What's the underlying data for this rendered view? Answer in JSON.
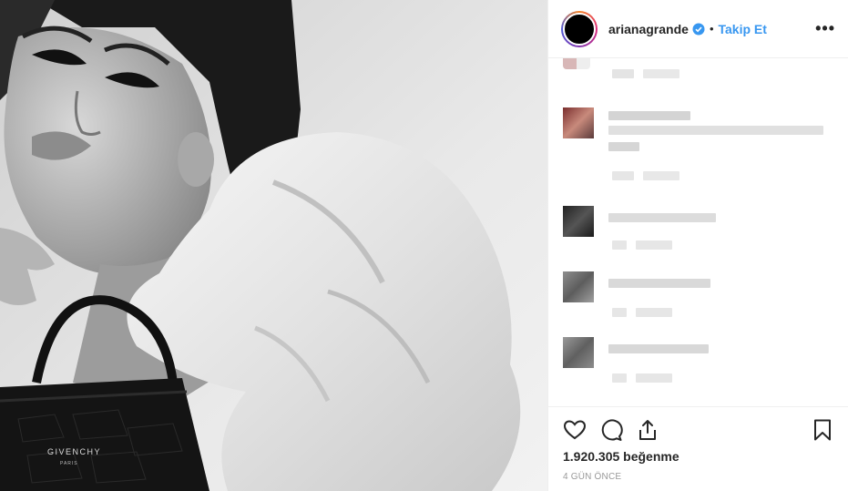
{
  "post": {
    "username": "arianagrande",
    "follow_label": "Takip Et",
    "separator": "•",
    "more_label": "•••",
    "likes_text": "1.920.305 beğenme",
    "timestamp": "4 GÜN ÖNCE",
    "brand_mark": "GIVENCHY",
    "brand_sub": "PARIS"
  },
  "colors": {
    "accent": "#3897f0",
    "verified": "#3897f0",
    "text": "#262626",
    "muted": "#999999",
    "border": "#efefef"
  },
  "icons": {
    "like": "heart-icon",
    "comment": "comment-icon",
    "share": "share-icon",
    "save": "bookmark-icon",
    "verified": "verified-badge-icon",
    "more": "more-options-icon"
  }
}
